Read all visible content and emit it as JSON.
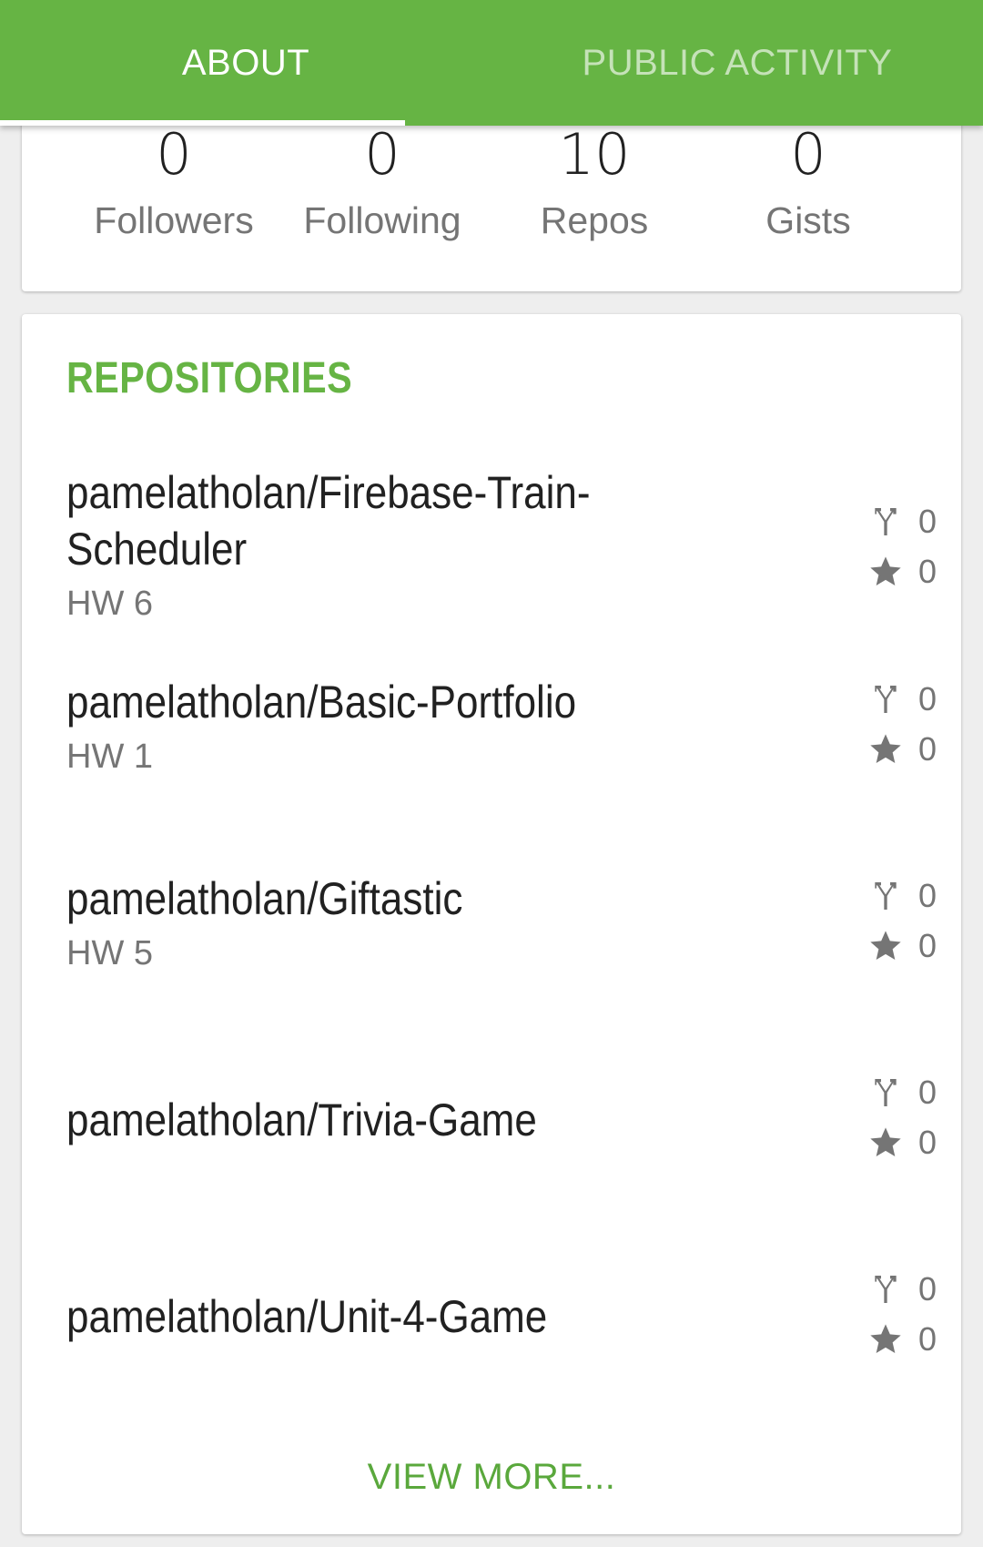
{
  "tabs": [
    {
      "label": "ABOUT",
      "selected": true
    },
    {
      "label": "PUBLIC ACTIVITY",
      "selected": false
    }
  ],
  "stats": [
    {
      "value": "0",
      "label": "Followers"
    },
    {
      "value": "0",
      "label": "Following"
    },
    {
      "value": "10",
      "label": "Repos"
    },
    {
      "value": "0",
      "label": "Gists"
    }
  ],
  "repositories": {
    "title": "REPOSITORIES",
    "items": [
      {
        "name": "pamelatholan/Firebase-Train-Scheduler",
        "description": "HW 6",
        "forks": "0",
        "stars": "0"
      },
      {
        "name": "pamelatholan/Basic-Portfolio",
        "description": "HW 1",
        "forks": "0",
        "stars": "0"
      },
      {
        "name": "pamelatholan/Giftastic",
        "description": "HW 5",
        "forks": "0",
        "stars": "0"
      },
      {
        "name": "pamelatholan/Trivia-Game",
        "description": "",
        "forks": "0",
        "stars": "0"
      },
      {
        "name": "pamelatholan/Unit-4-Game",
        "description": "",
        "forks": "0",
        "stars": "0"
      }
    ],
    "view_more": "VIEW MORE..."
  },
  "icons": {
    "fork": "fork-icon",
    "star": "star-icon"
  },
  "colors": {
    "accent": "#66b444",
    "text_primary": "#212121",
    "text_secondary": "#757575"
  }
}
